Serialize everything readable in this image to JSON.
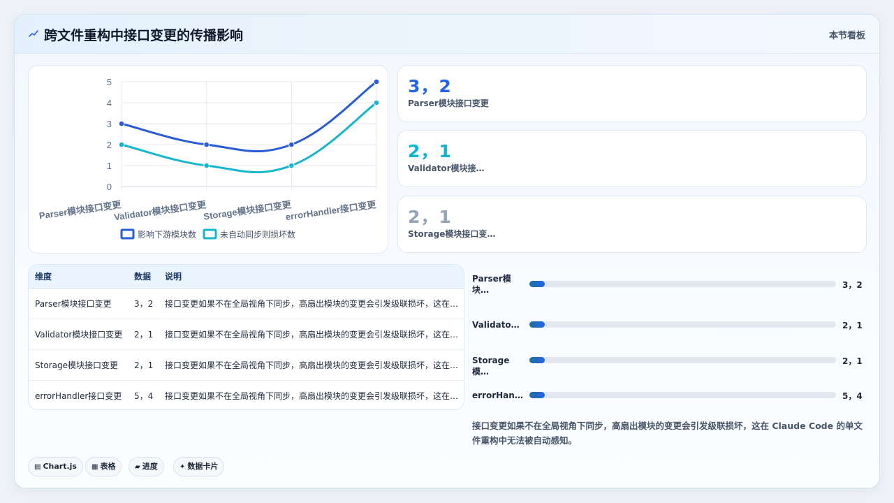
{
  "header": {
    "title": "跨文件重构中接口变更的传播影响",
    "badge": "本节看板"
  },
  "chart_data": {
    "type": "line",
    "categories": [
      "Parser模块接口变更",
      "Validator模块接口变更",
      "Storage模块接口变更",
      "errorHandler接口变更"
    ],
    "series": [
      {
        "name": "影响下游模块数",
        "values": [
          3,
          2,
          2,
          5
        ],
        "color": "#2a5bd7"
      },
      {
        "name": "未自动同步则损坏数",
        "values": [
          2,
          1,
          1,
          4
        ],
        "color": "#16b6cc"
      }
    ],
    "ylim": [
      0,
      5
    ],
    "yticks": [
      "0",
      "1",
      "2",
      "3",
      "4",
      "5"
    ],
    "grid": true,
    "legend": "bottom"
  },
  "stats": [
    {
      "value": "3，2",
      "label": "Parser模块接口变更",
      "color": "#2563eb"
    },
    {
      "value": "2，1",
      "label": "Validator模块接…",
      "color": "#06b6d4"
    },
    {
      "value": "2，1",
      "label": "Storage模块接口变…",
      "color": "#94a3b8"
    }
  ],
  "table": {
    "headers": [
      "维度",
      "数据",
      "说明"
    ],
    "rows": [
      [
        "Parser模块接口变更",
        "3，2",
        "接口变更如果不在全局视角下同步，高扇出模块的变更会引发级联损坏，这在…"
      ],
      [
        "Validator模块接口变更",
        "2，1",
        "接口变更如果不在全局视角下同步，高扇出模块的变更会引发级联损坏，这在…"
      ],
      [
        "Storage模块接口变更",
        "2，1",
        "接口变更如果不在全局视角下同步，高扇出模块的变更会引发级联损坏，这在…"
      ],
      [
        "errorHandler接口变更",
        "5，4",
        "接口变更如果不在全局视角下同步，高扇出模块的变更会引发级联损坏，这在…"
      ]
    ]
  },
  "progress": [
    {
      "label": "Parser模块…",
      "value": "3，2",
      "fraction": 0.05
    },
    {
      "label": "Validato…",
      "value": "2，1",
      "fraction": 0.05
    },
    {
      "label": "Storage模…",
      "value": "2，1",
      "fraction": 0.05
    },
    {
      "label": "errorHan…",
      "value": "5，4",
      "fraction": 0.05
    }
  ],
  "note": "接口变更如果不在全局视角下同步，高扇出模块的变更会引发级联损坏，这在 Claude Code 的单文件重构中无法被自动感知。",
  "chips": [
    {
      "icon": "▤",
      "label": "Chart.js"
    },
    {
      "icon": "▦",
      "label": "表格"
    },
    {
      "icon": "▰",
      "label": "进度"
    },
    {
      "icon": "✦",
      "label": "数据卡片"
    }
  ]
}
